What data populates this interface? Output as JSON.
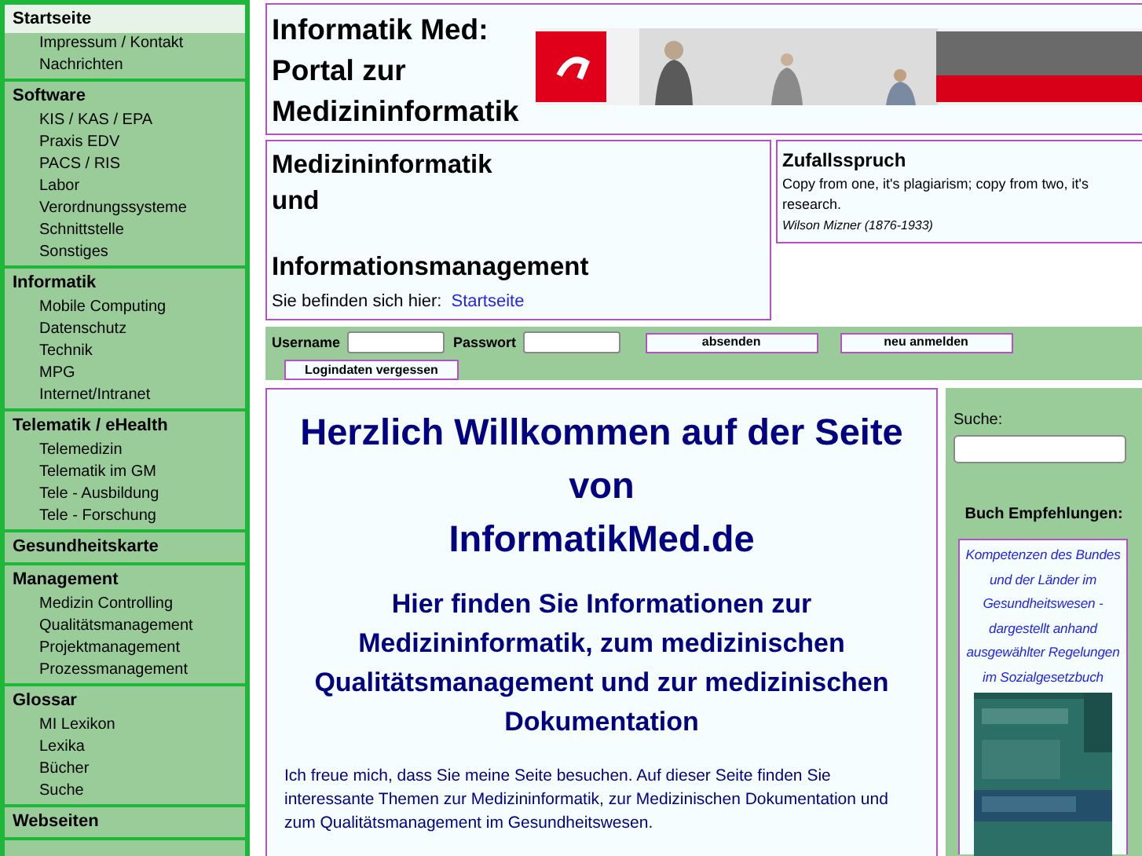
{
  "sidebar": {
    "sections": [
      {
        "title": "Startseite",
        "selected": true,
        "items": [
          "Impressum / Kontakt",
          "Nachrichten"
        ]
      },
      {
        "title": "Software",
        "selected": false,
        "items": [
          "KIS / KAS / EPA",
          "Praxis EDV",
          "PACS / RIS",
          "Labor",
          "Verordnungssysteme",
          "Schnittstelle",
          "Sonstiges"
        ]
      },
      {
        "title": "Informatik",
        "selected": false,
        "items": [
          "Mobile Computing",
          "Datenschutz",
          "Technik",
          "MPG",
          "Internet/Intranet"
        ]
      },
      {
        "title": "Telematik / eHealth",
        "selected": false,
        "items": [
          "Telemedizin",
          "Telematik im GM",
          "Tele - Ausbildung",
          "Tele - Forschung"
        ]
      },
      {
        "title": "Gesundheitskarte",
        "selected": false
      },
      {
        "title": "Management",
        "selected": false,
        "items": [
          "Medizin Controlling",
          "Qualitätsmanagement",
          "Projektmanagement",
          "Prozessmanagement"
        ]
      },
      {
        "title": "Glossar",
        "selected": false,
        "items": [
          "MI Lexikon",
          "Lexika",
          "Bücher",
          "Suche"
        ]
      },
      {
        "title": "Webseiten",
        "selected": false
      }
    ]
  },
  "header": {
    "title_lines": [
      "Informatik Med:",
      "Portal zur",
      "Medizininformatik"
    ]
  },
  "section_box": {
    "title_lines": [
      "Medizininformatik",
      "und",
      "Informationsmanagement"
    ],
    "breadcrumb_label": "Sie befinden sich hier:",
    "breadcrumb_link": "Startseite"
  },
  "quote": {
    "title": "Zufallsspruch",
    "text": "Copy from one, it's plagiarism; copy from two, it's research.",
    "author": "Wilson Mizner (1876-1933)"
  },
  "login": {
    "username_label": "Username",
    "password_label": "Passwort",
    "submit": "absenden",
    "register": "neu anmelden",
    "forgot": "Logindaten vergessen"
  },
  "main": {
    "heading_lines": [
      "Herzlich Willkommen auf der Seite",
      "von",
      "InformatikMed.de"
    ],
    "subheading": "Hier finden Sie Informationen zur Medizininformatik, zum medizinischen Qualitätsmanagement und zur medizinischen Dokumentation",
    "paragraph": "Ich freue mich, dass Sie meine Seite besuchen. Auf dieser Seite finden Sie interessante Themen zur Medizininformatik, zur Medizinischen Dokumentation und zum Qualitätsmanagement im Gesundheitswesen."
  },
  "aside": {
    "search_label": "Suche:",
    "books_title": "Buch Empfehlungen:",
    "book_title": "Kompetenzen des Bundes und der Länder im Gesundheitswesen - dargestellt anhand ausgewählter Regelungen im Sozialgesetzbuch"
  }
}
